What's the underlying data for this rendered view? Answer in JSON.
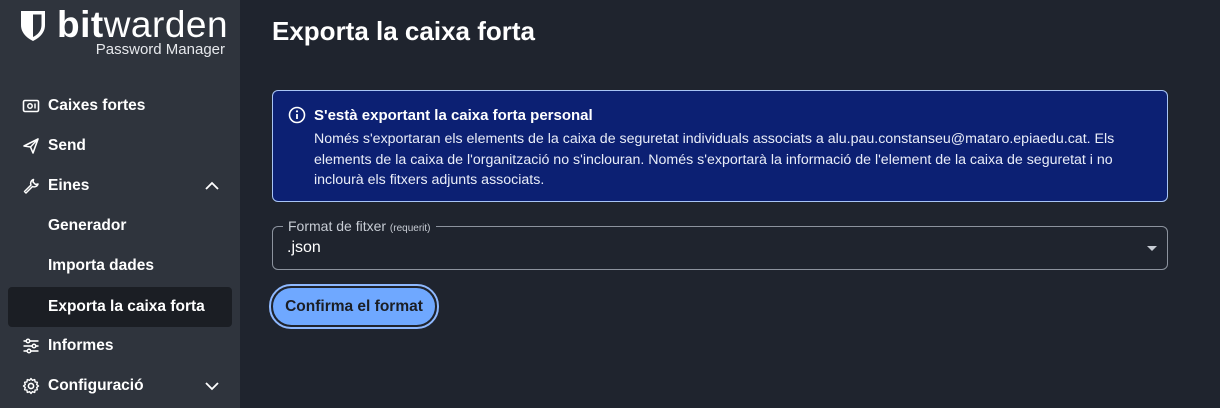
{
  "brand": {
    "word_bold": "bit",
    "word_regular": "warden",
    "subtitle": "Password Manager"
  },
  "sidebar": {
    "items": [
      {
        "label": "Caixes fortes",
        "icon": "vault-icon"
      },
      {
        "label": "Send",
        "icon": "send-icon"
      },
      {
        "label": "Eines",
        "icon": "wrench-icon",
        "expanded": true
      },
      {
        "label": "Generador"
      },
      {
        "label": "Importa dades"
      },
      {
        "label": "Exporta la caixa forta",
        "active": true
      },
      {
        "label": "Informes",
        "icon": "sliders-icon"
      },
      {
        "label": "Configuració",
        "icon": "gear-icon",
        "expanded": false
      }
    ]
  },
  "main": {
    "title": "Exporta la caixa forta",
    "callout": {
      "title": "S'està exportant la caixa forta personal",
      "body": "Només s'exportaran els elements de la caixa de seguretat individuals associats a alu.pau.constanseu@mataro.epiaedu.cat. Els elements de la caixa de l'organització no s'inclouran. Només s'exportarà la informació de l'element de la caixa de seguretat i no inclourà els fitxers adjunts associats."
    },
    "format_field": {
      "label": "Format de fitxer",
      "required_hint": "(requerit)",
      "value": ".json"
    },
    "confirm_button": "Confirma el format"
  },
  "colors": {
    "sidebar_bg": "#2f343d",
    "main_bg": "#1f242e",
    "callout_bg": "#0c2073",
    "callout_border": "#a8c4f5",
    "button_bg": "#6fa8ff"
  }
}
